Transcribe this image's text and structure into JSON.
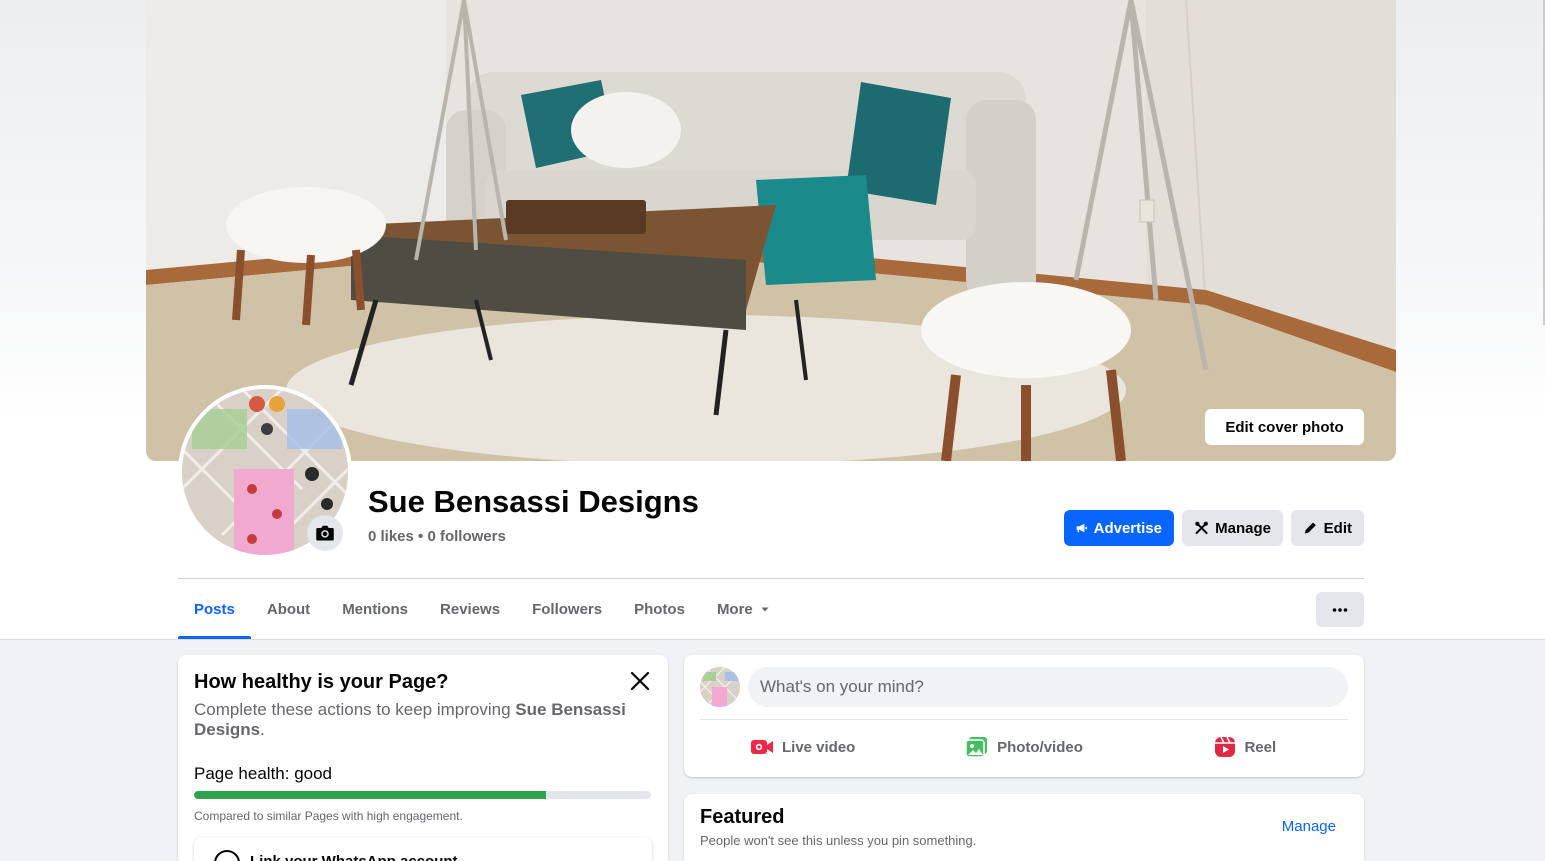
{
  "cover": {
    "edit_cover_label": "Edit cover photo"
  },
  "profile": {
    "name": "Sue Bensassi Designs",
    "stats": "0 likes • 0 followers"
  },
  "actions": {
    "advertise": "Advertise",
    "manage": "Manage",
    "edit": "Edit"
  },
  "tabs": [
    {
      "label": "Posts",
      "active": true
    },
    {
      "label": "About"
    },
    {
      "label": "Mentions"
    },
    {
      "label": "Reviews"
    },
    {
      "label": "Followers"
    },
    {
      "label": "Photos"
    },
    {
      "label": "More"
    }
  ],
  "health": {
    "title": "How healthy is your Page?",
    "desc_prefix": "Complete these actions to keep improving ",
    "desc_page": "Sue Bensassi Designs",
    "desc_suffix": ".",
    "label": "Page health: good",
    "progress": 0.77,
    "note": "Compared to similar Pages with high engagement.",
    "sub_item": "Link your WhatsApp account"
  },
  "composer": {
    "placeholder": "What's on your mind?",
    "live_video": "Live video",
    "photo_video": "Photo/video",
    "reel": "Reel"
  },
  "featured": {
    "title": "Featured",
    "subtitle": "People won't see this unless you pin something.",
    "manage": "Manage"
  },
  "colors": {
    "accent": "#0866ff",
    "health_good": "#31a24c",
    "live_red": "#f02849",
    "photo_green": "#45bd62",
    "reel_pink": "#e42645"
  }
}
